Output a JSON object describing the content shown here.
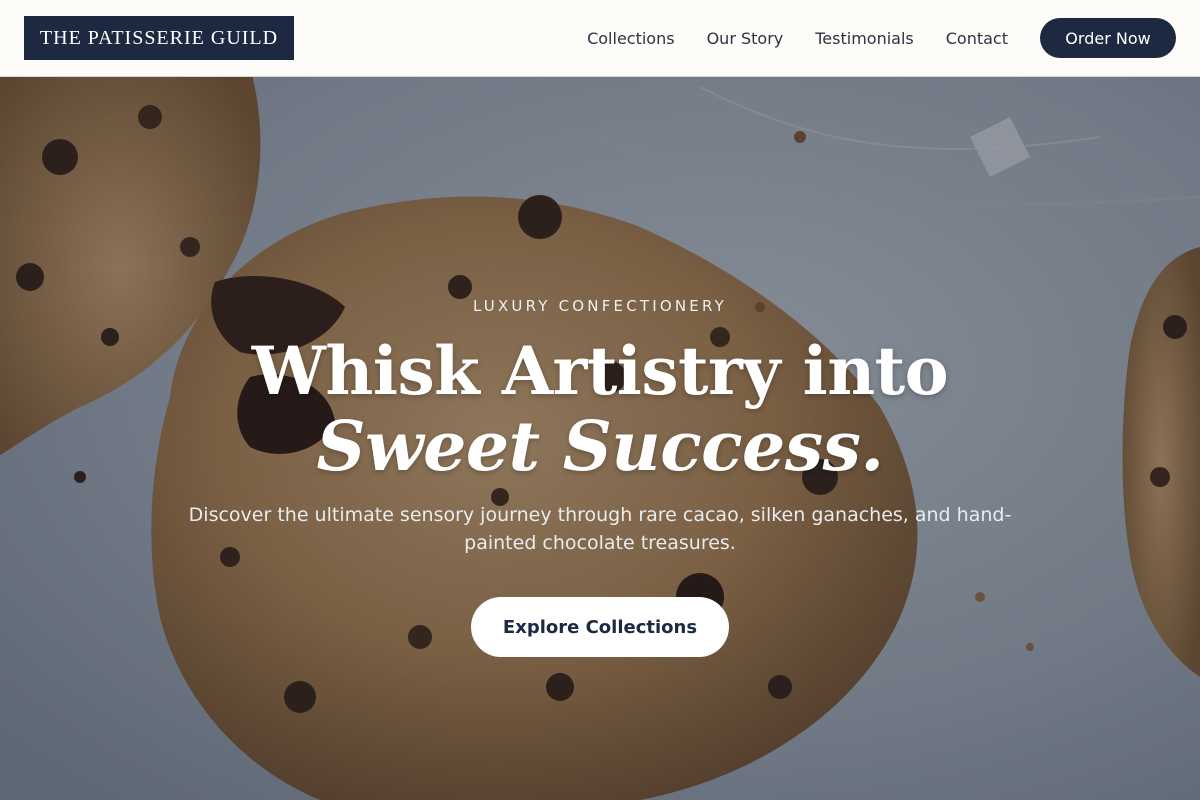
{
  "brand": {
    "name": "THE PATISSERIE GUILD"
  },
  "nav": {
    "links": [
      {
        "label": "Collections"
      },
      {
        "label": "Our Story"
      },
      {
        "label": "Testimonials"
      },
      {
        "label": "Contact"
      }
    ],
    "cta_label": "Order Now"
  },
  "hero": {
    "eyebrow": "LUXURY CONFECTIONERY",
    "headline_line1": "Whisk Artistry into",
    "headline_line2": "Sweet Success.",
    "subtitle": "Discover the ultimate sensory journey through rare cacao, silken ganaches, and hand-painted chocolate treasures.",
    "button_label": "Explore Collections",
    "background_image": "chocolate-chip-cookies-photo"
  },
  "colors": {
    "navy": "#1c2940",
    "header_bg": "#fdfcf9",
    "white": "#ffffff"
  }
}
